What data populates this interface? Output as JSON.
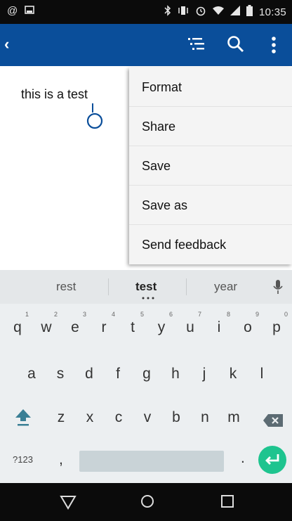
{
  "status_bar": {
    "time": "10:35",
    "left_icons": [
      "at-sign-icon",
      "image-icon"
    ],
    "right_icons": [
      "bluetooth-icon",
      "vibrate-icon",
      "alarm-icon",
      "wifi-icon",
      "signal-icon",
      "battery-icon"
    ]
  },
  "app_bar": {
    "color": "#0a4e9a",
    "back_glyph": "‹"
  },
  "editor": {
    "text": "this is a test"
  },
  "menu": {
    "items": [
      "Format",
      "Share",
      "Save",
      "Save as",
      "Send feedback"
    ]
  },
  "keyboard": {
    "suggestions": [
      "rest",
      "test",
      "year"
    ],
    "row1": [
      "q",
      "w",
      "e",
      "r",
      "t",
      "y",
      "u",
      "i",
      "o",
      "p"
    ],
    "row1_numbers": [
      "1",
      "2",
      "3",
      "4",
      "5",
      "6",
      "7",
      "8",
      "9",
      "0"
    ],
    "row2": [
      "a",
      "s",
      "d",
      "f",
      "g",
      "h",
      "j",
      "k",
      "l"
    ],
    "row3": [
      "z",
      "x",
      "c",
      "v",
      "b",
      "n",
      "m"
    ],
    "symbols_key": "?123",
    "comma_key": ",",
    "period_key": ".",
    "enter_color": "#1ec48f"
  }
}
